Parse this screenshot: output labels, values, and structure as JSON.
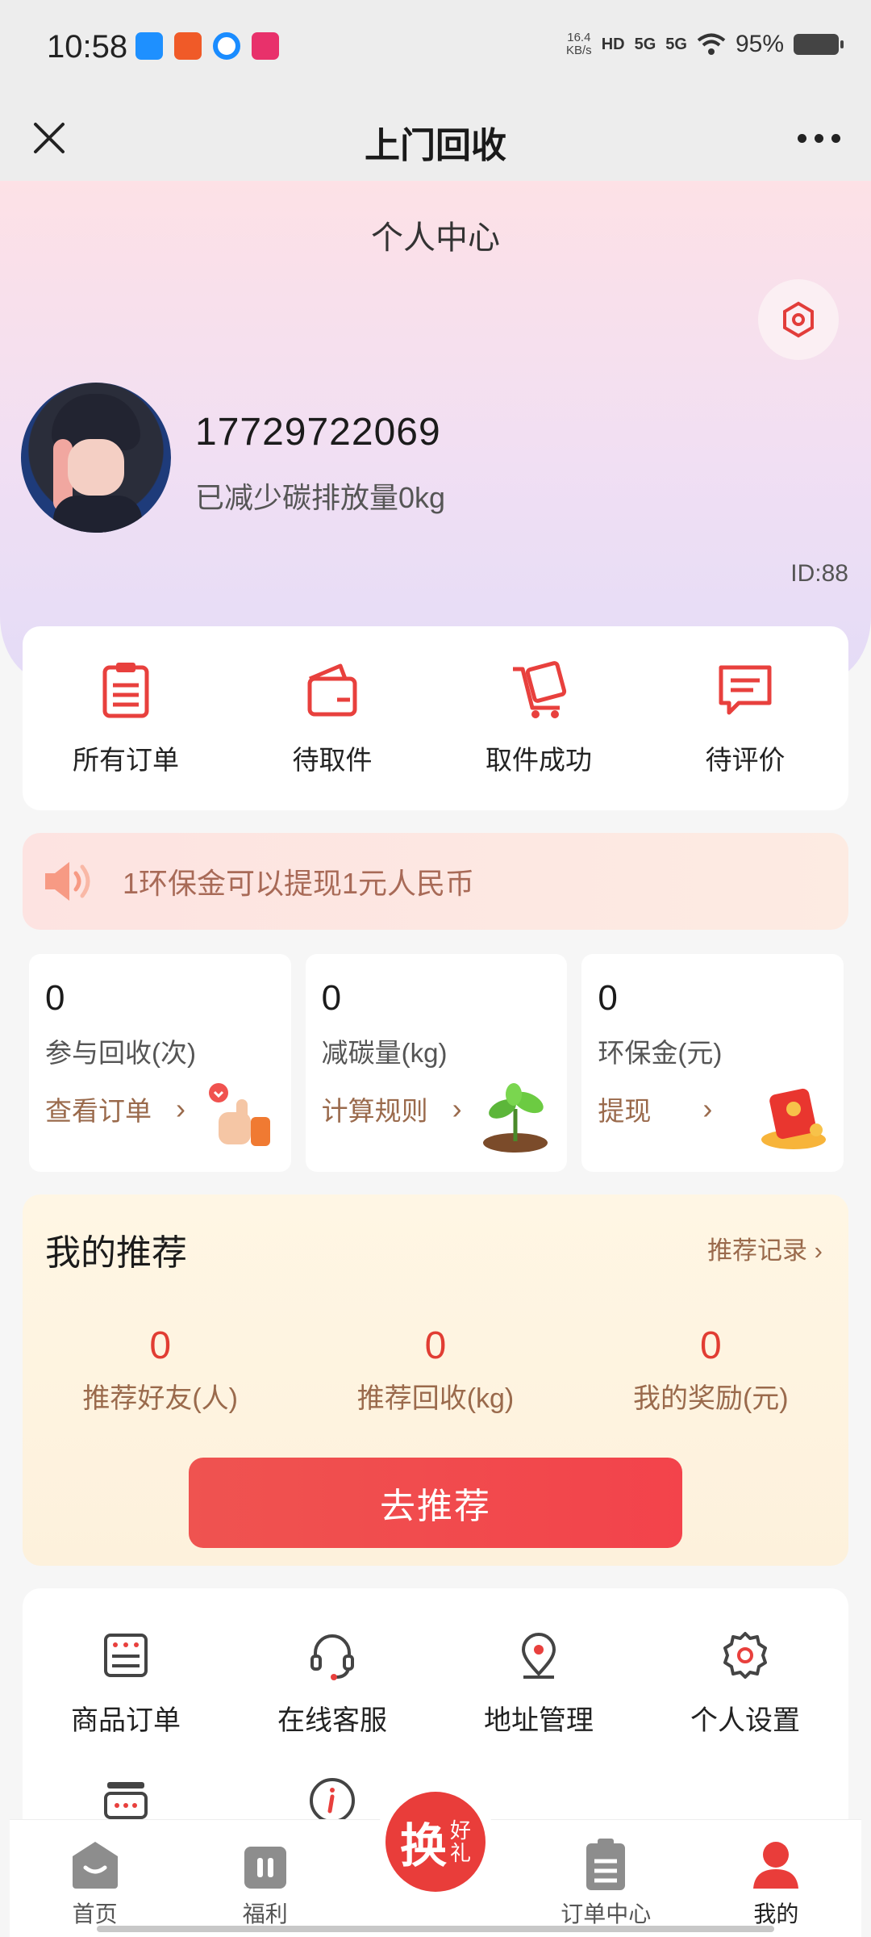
{
  "status_bar": {
    "time": "10:58",
    "net_speed_value": "16.4",
    "net_speed_unit": "KB/s",
    "hd": "HD",
    "signal1": "5G",
    "signal2": "5G",
    "battery": "95%"
  },
  "nav": {
    "title": "上门回收"
  },
  "profile": {
    "section_title": "个人中心",
    "phone": "17729722069",
    "carbon_text": "已减少碳排放量0kg",
    "id_text": "ID:88"
  },
  "orders": [
    {
      "label": "所有订单",
      "icon": "clipboard-list-icon"
    },
    {
      "label": "待取件",
      "icon": "wallet-icon"
    },
    {
      "label": "取件成功",
      "icon": "cart-box-icon"
    },
    {
      "label": "待评价",
      "icon": "comment-icon"
    }
  ],
  "notice": {
    "text": "1环保金可以提现1元人民币"
  },
  "stats": [
    {
      "value": "0",
      "label": "参与回收(次)",
      "link": "查看订单"
    },
    {
      "value": "0",
      "label": "减碳量(kg)",
      "link": "计算规则"
    },
    {
      "value": "0",
      "label": "环保金(元)",
      "link": "提现"
    }
  ],
  "recommend": {
    "title": "我的推荐",
    "record_link": "推荐记录",
    "stats": [
      {
        "value": "0",
        "label": "推荐好友(人)"
      },
      {
        "value": "0",
        "label": "推荐回收(kg)"
      },
      {
        "value": "0",
        "label": "我的奖励(元)"
      }
    ],
    "button": "去推荐"
  },
  "tools": [
    {
      "label": "商品订单",
      "icon": "order-list-icon"
    },
    {
      "label": "在线客服",
      "icon": "headset-icon"
    },
    {
      "label": "地址管理",
      "icon": "location-pin-icon"
    },
    {
      "label": "个人设置",
      "icon": "gear-icon"
    }
  ],
  "tabs": [
    {
      "label": "首页",
      "icon": "home-icon"
    },
    {
      "label": "福利",
      "icon": "gift-icon"
    },
    {
      "label": "订单中心",
      "icon": "order-center-icon"
    },
    {
      "label": "我的",
      "icon": "user-icon"
    }
  ],
  "center_tab": {
    "big": "换",
    "small_top": "好",
    "small_bottom": "礼"
  },
  "colors": {
    "accent_red": "#e93d3a",
    "brown_text": "#9a6a4c"
  }
}
